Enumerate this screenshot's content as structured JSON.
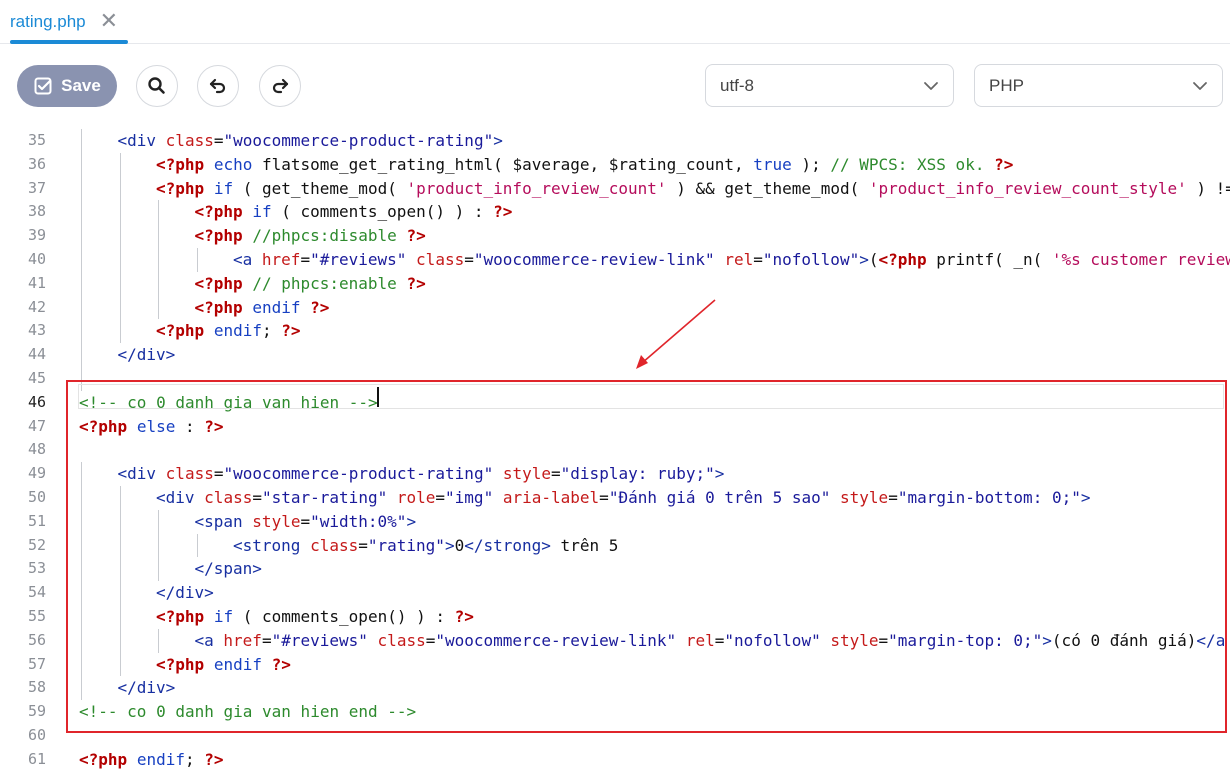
{
  "tab": {
    "label": "rating.php",
    "close_icon": "close-icon"
  },
  "toolbar": {
    "save_label": "Save",
    "encoding": "utf-8",
    "language": "PHP"
  },
  "editor": {
    "active_line": 46,
    "lines": [
      {
        "n": 35,
        "indent": 1,
        "tokens": [
          [
            "t",
            "<div "
          ],
          [
            "a",
            "class"
          ],
          [
            "p",
            "="
          ],
          [
            "s",
            "\"woocommerce-product-rating\""
          ],
          [
            "t",
            ">"
          ]
        ]
      },
      {
        "n": 36,
        "indent": 2,
        "tokens": [
          [
            "h",
            "<?php"
          ],
          [
            "p",
            " "
          ],
          [
            "k",
            "echo"
          ],
          [
            "p",
            " flatsome_get_rating_html( "
          ],
          [
            "v",
            "$average"
          ],
          [
            "p",
            ", "
          ],
          [
            "v",
            "$rating_count"
          ],
          [
            "p",
            ", "
          ],
          [
            "k",
            "true"
          ],
          [
            "p",
            " ); "
          ],
          [
            "c",
            "// WPCS: XSS ok."
          ],
          [
            "p",
            " "
          ],
          [
            "h",
            "?>"
          ]
        ]
      },
      {
        "n": 37,
        "indent": 2,
        "tokens": [
          [
            "h",
            "<?php"
          ],
          [
            "p",
            " "
          ],
          [
            "k",
            "if"
          ],
          [
            "p",
            " ( get_theme_mod( "
          ],
          [
            "q",
            "'product_info_review_count'"
          ],
          [
            "p",
            " ) && get_theme_mod( "
          ],
          [
            "q",
            "'product_info_review_count_style'"
          ],
          [
            "p",
            " ) !="
          ]
        ]
      },
      {
        "n": 38,
        "indent": 3,
        "tokens": [
          [
            "h",
            "<?php"
          ],
          [
            "p",
            " "
          ],
          [
            "k",
            "if"
          ],
          [
            "p",
            " ( comments_open() ) : "
          ],
          [
            "h",
            "?>"
          ]
        ]
      },
      {
        "n": 39,
        "indent": 3,
        "tokens": [
          [
            "h",
            "<?php"
          ],
          [
            "p",
            " "
          ],
          [
            "c",
            "//phpcs:disable"
          ],
          [
            "p",
            " "
          ],
          [
            "h",
            "?>"
          ]
        ]
      },
      {
        "n": 40,
        "indent": 4,
        "tokens": [
          [
            "t",
            "<a "
          ],
          [
            "a",
            "href"
          ],
          [
            "p",
            "="
          ],
          [
            "s",
            "\"#reviews\""
          ],
          [
            "p",
            " "
          ],
          [
            "a",
            "class"
          ],
          [
            "p",
            "="
          ],
          [
            "s",
            "\"woocommerce-review-link\""
          ],
          [
            "p",
            " "
          ],
          [
            "a",
            "rel"
          ],
          [
            "p",
            "="
          ],
          [
            "s",
            "\"nofollow\""
          ],
          [
            "t",
            ">"
          ],
          [
            "p",
            "("
          ],
          [
            "h",
            "<?php"
          ],
          [
            "p",
            " printf( _n( "
          ],
          [
            "q",
            "'%s customer review"
          ]
        ]
      },
      {
        "n": 41,
        "indent": 3,
        "tokens": [
          [
            "h",
            "<?php"
          ],
          [
            "p",
            " "
          ],
          [
            "c",
            "// phpcs:enable"
          ],
          [
            "p",
            " "
          ],
          [
            "h",
            "?>"
          ]
        ]
      },
      {
        "n": 42,
        "indent": 3,
        "tokens": [
          [
            "h",
            "<?php"
          ],
          [
            "p",
            " "
          ],
          [
            "k",
            "endif"
          ],
          [
            "p",
            " "
          ],
          [
            "h",
            "?>"
          ]
        ]
      },
      {
        "n": 43,
        "indent": 2,
        "tokens": [
          [
            "h",
            "<?php"
          ],
          [
            "p",
            " "
          ],
          [
            "k",
            "endif"
          ],
          [
            "p",
            "; "
          ],
          [
            "h",
            "?>"
          ]
        ]
      },
      {
        "n": 44,
        "indent": 1,
        "tokens": [
          [
            "t",
            "</div>"
          ]
        ]
      },
      {
        "n": 45,
        "indent": 0,
        "tokens": []
      },
      {
        "n": 46,
        "indent": 0,
        "tokens": [
          [
            "c",
            "<!-- co 0 danh gia van hien -->"
          ]
        ]
      },
      {
        "n": 47,
        "indent": 0,
        "tokens": [
          [
            "h",
            "<?php"
          ],
          [
            "p",
            " "
          ],
          [
            "k",
            "else"
          ],
          [
            "p",
            " : "
          ],
          [
            "h",
            "?>"
          ]
        ]
      },
      {
        "n": 48,
        "indent": 0,
        "tokens": []
      },
      {
        "n": 49,
        "indent": 1,
        "tokens": [
          [
            "t",
            "<div "
          ],
          [
            "a",
            "class"
          ],
          [
            "p",
            "="
          ],
          [
            "s",
            "\"woocommerce-product-rating\""
          ],
          [
            "p",
            " "
          ],
          [
            "a",
            "style"
          ],
          [
            "p",
            "="
          ],
          [
            "s",
            "\"display: ruby;\""
          ],
          [
            "t",
            ">"
          ]
        ]
      },
      {
        "n": 50,
        "indent": 2,
        "tokens": [
          [
            "t",
            "<div "
          ],
          [
            "a",
            "class"
          ],
          [
            "p",
            "="
          ],
          [
            "s",
            "\"star-rating\""
          ],
          [
            "p",
            " "
          ],
          [
            "a",
            "role"
          ],
          [
            "p",
            "="
          ],
          [
            "s",
            "\"img\""
          ],
          [
            "p",
            " "
          ],
          [
            "a",
            "aria-label"
          ],
          [
            "p",
            "="
          ],
          [
            "s",
            "\"Đánh giá 0 trên 5 sao\""
          ],
          [
            "p",
            " "
          ],
          [
            "a",
            "style"
          ],
          [
            "p",
            "="
          ],
          [
            "s",
            "\"margin-bottom: 0;\""
          ],
          [
            "t",
            ">"
          ]
        ]
      },
      {
        "n": 51,
        "indent": 3,
        "tokens": [
          [
            "t",
            "<span "
          ],
          [
            "a",
            "style"
          ],
          [
            "p",
            "="
          ],
          [
            "s",
            "\"width:0%\""
          ],
          [
            "t",
            ">"
          ]
        ]
      },
      {
        "n": 52,
        "indent": 4,
        "tokens": [
          [
            "t",
            "<strong "
          ],
          [
            "a",
            "class"
          ],
          [
            "p",
            "="
          ],
          [
            "s",
            "\"rating\""
          ],
          [
            "t",
            ">"
          ],
          [
            "p",
            "0"
          ],
          [
            "t",
            "</strong>"
          ],
          [
            "p",
            " trên 5"
          ]
        ]
      },
      {
        "n": 53,
        "indent": 3,
        "tokens": [
          [
            "t",
            "</span>"
          ]
        ]
      },
      {
        "n": 54,
        "indent": 2,
        "tokens": [
          [
            "t",
            "</div>"
          ]
        ]
      },
      {
        "n": 55,
        "indent": 2,
        "tokens": [
          [
            "h",
            "<?php"
          ],
          [
            "p",
            " "
          ],
          [
            "k",
            "if"
          ],
          [
            "p",
            " ( comments_open() ) : "
          ],
          [
            "h",
            "?>"
          ]
        ]
      },
      {
        "n": 56,
        "indent": 3,
        "tokens": [
          [
            "t",
            "<a "
          ],
          [
            "a",
            "href"
          ],
          [
            "p",
            "="
          ],
          [
            "s",
            "\"#reviews\""
          ],
          [
            "p",
            " "
          ],
          [
            "a",
            "class"
          ],
          [
            "p",
            "="
          ],
          [
            "s",
            "\"woocommerce-review-link\""
          ],
          [
            "p",
            " "
          ],
          [
            "a",
            "rel"
          ],
          [
            "p",
            "="
          ],
          [
            "s",
            "\"nofollow\""
          ],
          [
            "p",
            " "
          ],
          [
            "a",
            "style"
          ],
          [
            "p",
            "="
          ],
          [
            "s",
            "\"margin-top: 0;\""
          ],
          [
            "t",
            ">"
          ],
          [
            "p",
            "(có 0 đánh giá)"
          ],
          [
            "t",
            "</a"
          ]
        ]
      },
      {
        "n": 57,
        "indent": 2,
        "tokens": [
          [
            "h",
            "<?php"
          ],
          [
            "p",
            " "
          ],
          [
            "k",
            "endif"
          ],
          [
            "p",
            " "
          ],
          [
            "h",
            "?>"
          ]
        ]
      },
      {
        "n": 58,
        "indent": 1,
        "tokens": [
          [
            "t",
            "</div>"
          ]
        ]
      },
      {
        "n": 59,
        "indent": 0,
        "tokens": [
          [
            "c",
            "<!-- co 0 danh gia van hien end -->"
          ]
        ]
      },
      {
        "n": 60,
        "indent": 0,
        "tokens": []
      },
      {
        "n": 61,
        "indent": 0,
        "tokens": [
          [
            "h",
            "<?php"
          ],
          [
            "p",
            " "
          ],
          [
            "k",
            "endif"
          ],
          [
            "p",
            "; "
          ],
          [
            "h",
            "?>"
          ]
        ]
      }
    ]
  },
  "colors": {
    "accent": "#1b8ad6",
    "save_button": "#8a93b0",
    "highlight": "#e0252b"
  }
}
